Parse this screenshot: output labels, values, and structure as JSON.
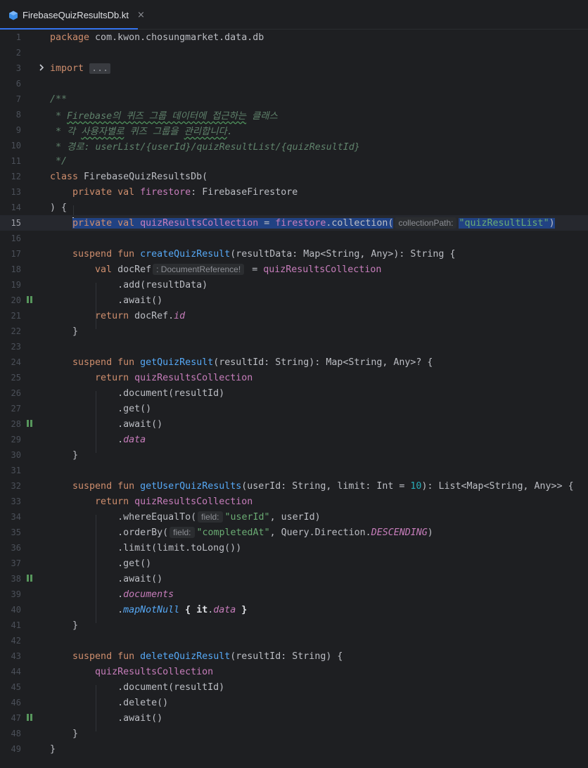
{
  "tab": {
    "title": "FirebaseQuizResultsDb.kt",
    "close_glyph": "×",
    "icon": "kotlin-file-icon"
  },
  "colors": {
    "accent": "#3574f0",
    "keyword": "#cf8e6d",
    "property": "#c77dbb",
    "function": "#56a8f5",
    "string": "#6aab73",
    "number": "#2aacb8",
    "comment": "#5f826b"
  },
  "editor": {
    "current_line": 15,
    "line_numbers": [
      "1",
      "2",
      "3",
      "6",
      "7",
      "8",
      "9",
      "10",
      "11",
      "12",
      "13",
      "14",
      "15",
      "16",
      "17",
      "18",
      "19",
      "20",
      "21",
      "22",
      "23",
      "24",
      "25",
      "26",
      "27",
      "28",
      "29",
      "30",
      "31",
      "32",
      "33",
      "34",
      "35",
      "36",
      "37",
      "38",
      "39",
      "40",
      "41",
      "42",
      "43",
      "44",
      "45",
      "46",
      "47",
      "48",
      "49"
    ],
    "suspend_markers": [
      "20",
      "28",
      "38",
      "47"
    ],
    "code": {
      "l1": [
        "package",
        " com.kwon.chosungmarket.data.db"
      ],
      "l3": [
        "import",
        " ",
        "..."
      ],
      "l7": "/**",
      "l8": [
        " * ",
        "Firebase의 퀴즈 그룹 데이터에 접근하는",
        " 클래스"
      ],
      "l9": [
        " * 각 ",
        "사용자별로",
        " 퀴즈 그룹을 ",
        "관리합니다",
        "."
      ],
      "l10": " * 경로: userList/{userId}/quizResultList/{quizResultId}",
      "l11": " */",
      "l12": [
        "class",
        " FirebaseQuizResultsDb("
      ],
      "l13": [
        "private",
        " ",
        "val",
        " ",
        "firestore",
        ": FirebaseFirestore"
      ],
      "l14": ") {",
      "l15": [
        "private",
        " ",
        "val",
        " ",
        "quizResultsCollection",
        " = ",
        "firestore",
        ".collection(",
        "collectionPath:",
        "\"quizResultList\"",
        ")"
      ],
      "l17": [
        "suspend",
        " ",
        "fun",
        " ",
        "createQuizResult",
        "(resultData: Map<String, Any>): String {"
      ],
      "l18": [
        "val",
        " docRef",
        ": DocumentReference!",
        " = ",
        "quizResultsCollection"
      ],
      "l19": ".add(resultData)",
      "l20": ".await()",
      "l21": [
        "return",
        " docRef.",
        "id"
      ],
      "l22": "}",
      "l24": [
        "suspend",
        " ",
        "fun",
        " ",
        "getQuizResult",
        "(resultId: String): Map<String, Any>? {"
      ],
      "l25": [
        "return",
        " ",
        "quizResultsCollection"
      ],
      "l26": ".document(resultId)",
      "l27": ".get()",
      "l28": ".await()",
      "l29": [
        ".",
        "data"
      ],
      "l30": "}",
      "l32": [
        "suspend",
        " ",
        "fun",
        " ",
        "getUserQuizResults",
        "(userId: String, limit: Int = ",
        "10",
        "): List<Map<String, Any>> {"
      ],
      "l33": [
        "return",
        " ",
        "quizResultsCollection"
      ],
      "l34": [
        ".whereEqualTo(",
        "field:",
        "\"userId\"",
        ", userId)"
      ],
      "l35": [
        ".orderBy(",
        "field:",
        "\"completedAt\"",
        ", Query.Direction.",
        "DESCENDING",
        ")"
      ],
      "l36": ".limit(limit.toLong())",
      "l37": ".get()",
      "l38": ".await()",
      "l39": [
        ".",
        "documents"
      ],
      "l40": [
        ".",
        "mapNotNull",
        " { ",
        "it",
        ".",
        "data",
        " }"
      ],
      "l41": "}",
      "l43": [
        "suspend",
        " ",
        "fun",
        " ",
        "deleteQuizResult",
        "(resultId: String) {"
      ],
      "l44": "quizResultsCollection",
      "l45": ".document(resultId)",
      "l46": ".delete()",
      "l47": ".await()",
      "l48": "}",
      "l49": "}"
    }
  }
}
